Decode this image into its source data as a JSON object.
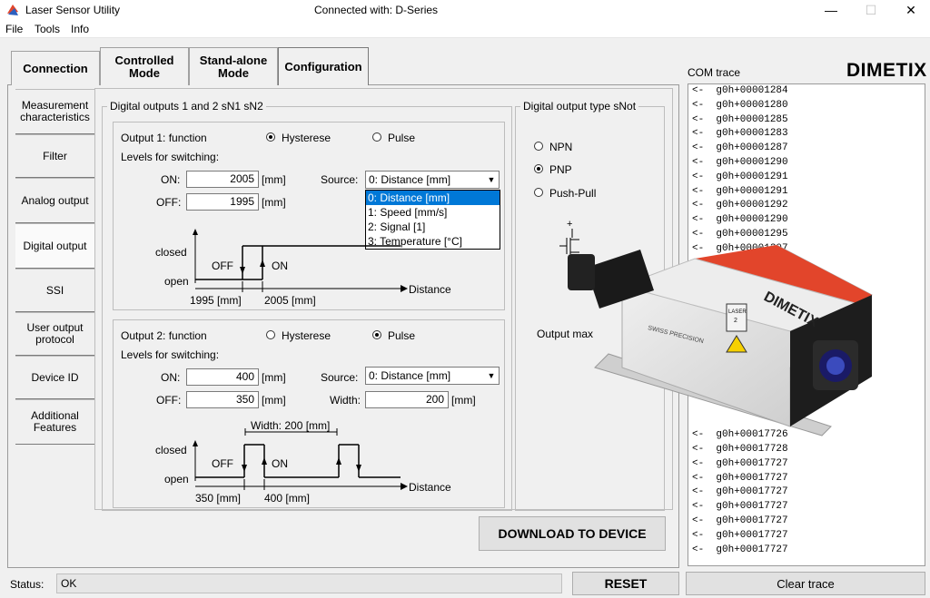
{
  "window": {
    "app_title": "Laser Sensor Utility",
    "connection_title": "Connected with: D-Series",
    "minimize_glyph": "—",
    "maximize_glyph": "☐",
    "close_glyph": "✕"
  },
  "menu": [
    "File",
    "Tools",
    "Info"
  ],
  "tabs": [
    {
      "label": "Connection"
    },
    {
      "label": "Controlled Mode"
    },
    {
      "label": "Stand-alone Mode"
    },
    {
      "label": "Configuration"
    }
  ],
  "side_tabs": [
    {
      "label": "Measurement characteristics"
    },
    {
      "label": "Filter"
    },
    {
      "label": "Analog output"
    },
    {
      "label": "Digital output"
    },
    {
      "label": "SSI"
    },
    {
      "label": "User output protocol"
    },
    {
      "label": "Device ID"
    },
    {
      "label": "Additional Features"
    }
  ],
  "digital_outputs": {
    "legend": "Digital outputs 1 and 2 sN1 sN2",
    "output1": {
      "function_label": "Output 1: function",
      "hysterese_label": "Hysterese",
      "pulse_label": "Pulse",
      "mode": "Hysterese",
      "levels_label": "Levels for switching:",
      "on_label": "ON:",
      "on_value": "2005",
      "off_label": "OFF:",
      "off_value": "1995",
      "unit": "[mm]",
      "source_label": "Source:",
      "source_value": "0: Distance [mm]",
      "source_options": [
        "0: Distance [mm]",
        "1: Speed [mm/s]",
        "2: Signal [1]",
        "3: Temperature [°C]"
      ],
      "diagram": {
        "closed": "closed",
        "open": "open",
        "off": "OFF",
        "on": "ON",
        "x1": "1995 [mm]",
        "x2": "2005 [mm]",
        "axis": "Distance"
      }
    },
    "output2": {
      "function_label": "Output 2: function",
      "hysterese_label": "Hysterese",
      "pulse_label": "Pulse",
      "mode": "Pulse",
      "levels_label": "Levels for switching:",
      "on_label": "ON:",
      "on_value": "400",
      "off_label": "OFF:",
      "off_value": "350",
      "unit": "[mm]",
      "source_label": "Source:",
      "source_value": "0: Distance [mm]",
      "width_label": "Width:",
      "width_value": "200",
      "diagram": {
        "width_text": "Width: 200 [mm]",
        "closed": "closed",
        "open": "open",
        "off": "OFF",
        "on": "ON",
        "x1": "350 [mm]",
        "x2": "400 [mm]",
        "axis": "Distance"
      }
    }
  },
  "output_type": {
    "legend": "Digital output type sNot",
    "options": [
      "NPN",
      "PNP",
      "Push-Pull"
    ],
    "selected": "PNP",
    "output_max_label": "Output max"
  },
  "download_button": "DOWNLOAD TO DEVICE",
  "com_trace": {
    "label": "COM trace",
    "logo": "DIMETIX",
    "lines": [
      "<-  g0h+00001284",
      "<-  g0h+00001280",
      "<-  g0h+00001285",
      "<-  g0h+00001283",
      "<-  g0h+00001287",
      "<-  g0h+00001290",
      "<-  g0h+00001291",
      "<-  g0h+00001291",
      "<-  g0h+00001292",
      "<-  g0h+00001290",
      "<-  g0h+00001295",
      "<-  g0h+00001307",
      "",
      "",
      "",
      "",
      "",
      "",
      "",
      "",
      "",
      "",
      "",
      "",
      "<-  g0h+00017726",
      "<-  g0h+00017728",
      "<-  g0h+00017727",
      "<-  g0h+00017727",
      "<-  g0h+00017727",
      "<-  g0h+00017727",
      "<-  g0h+00017727",
      "<-  g0h+00017727",
      "<-  g0h+00017727"
    ]
  },
  "status": {
    "label": "Status:",
    "value": "OK"
  },
  "reset_button": "RESET",
  "clear_trace_button": "Clear trace",
  "device_image": {
    "brand": "DIMETIX",
    "swiss": "SWISS PRECISION",
    "laser": "LASER",
    "laser_class": "2"
  },
  "colors": {
    "accent": "#0078d7",
    "device_red": "#e2452b"
  }
}
